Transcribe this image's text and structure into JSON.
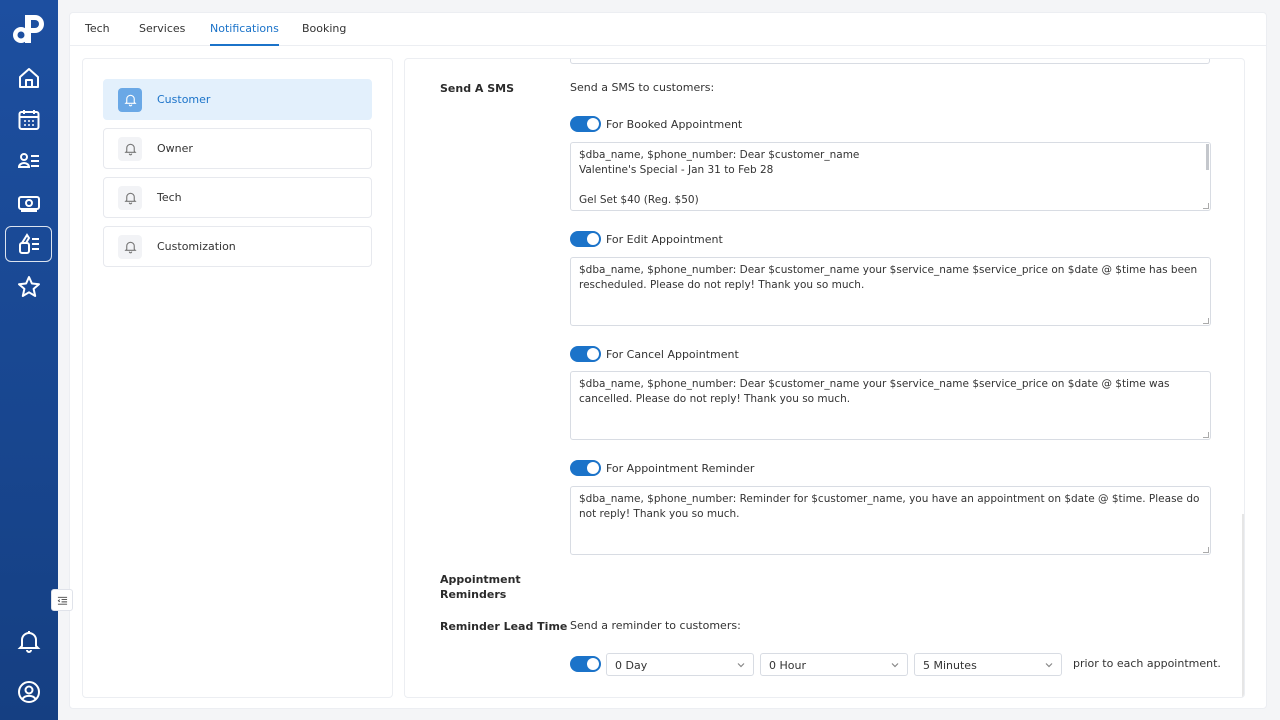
{
  "tabs": [
    "Tech",
    "Services",
    "Notifications",
    "Booking"
  ],
  "active_tab": "Notifications",
  "side_menu": [
    "Customer",
    "Owner",
    "Tech",
    "Customization"
  ],
  "active_side_item": "Customer",
  "send_sms": {
    "label": "Send A SMS",
    "intro": "Send a SMS to customers:",
    "booked_label": "For Booked Appointment",
    "booked_message": "$dba_name, $phone_number: Dear $customer_name\nValentine's Special - Jan 31 to Feb 28\n\nGel Set $40 (Reg. $50)",
    "edit_label": "For Edit Appointment",
    "edit_message": "$dba_name, $phone_number: Dear $customer_name your $service_name $service_price on $date @ $time has been rescheduled. Please do not reply! Thank you so much.",
    "cancel_label": "For Cancel Appointment",
    "cancel_message": "$dba_name, $phone_number: Dear $customer_name your $service_name $service_price on $date @ $time was cancelled. Please do not reply! Thank you so much.",
    "reminder_label": "For Appointment Reminder",
    "reminder_message": "$dba_name, $phone_number: Reminder for $customer_name, you have an appointment on $date @ $time. Please do not reply! Thank you so much."
  },
  "appointment_reminders_label_line1": "Appointment",
  "appointment_reminders_label_line2": "Reminders",
  "reminder_lead_time": {
    "label": "Reminder Lead Time",
    "intro": "Send a reminder to customers:",
    "day": "0 Day",
    "hour": "0 Hour",
    "minutes": "5 Minutes",
    "suffix": "prior to each appointment."
  },
  "colors": {
    "accent": "#1b73c9",
    "rail": "#1d4fa0",
    "active_bg": "#e3f0fc"
  },
  "icons": [
    "logo-icon",
    "home-icon",
    "calendar-icon",
    "customer-list-icon",
    "money-icon",
    "nail-polish-icon",
    "star-icon",
    "bell-icon",
    "user-circle-icon",
    "collapse-icon"
  ]
}
